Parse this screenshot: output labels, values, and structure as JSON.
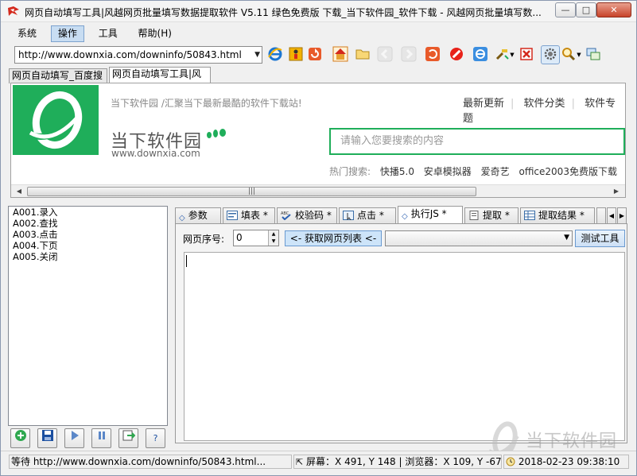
{
  "window": {
    "title": "网页自动填写工具|风越网页批量填写数据提取软件 V5.11 绿色免费版 下载_当下软件园_软件下载 - 风越网页批量填写数...",
    "controls": {
      "minimize": "—",
      "maximize": "□",
      "close": "✕"
    }
  },
  "menu": {
    "items": [
      {
        "label": "系统"
      },
      {
        "label": "操作",
        "active": true
      },
      {
        "label": "工具"
      },
      {
        "label": "帮助(H)"
      }
    ]
  },
  "toolbar": {
    "url": "http://www.downxia.com/downinfo/50843.html"
  },
  "browser_tabs": [
    {
      "label": "网页自动填写_百度搜"
    },
    {
      "label": "网页自动填写工具|风",
      "active": true
    }
  ],
  "webpage": {
    "tagline": "当下软件园 /汇聚当下最新最酷的软件下载站!",
    "nav": [
      "最新更新",
      "软件分类",
      "软件专题"
    ],
    "site_name": "当下软件园",
    "domain": "www.downxia.com",
    "search_placeholder": "请输入您要搜索的内容",
    "hot_label": "热门搜索:",
    "hot_items": [
      "快播5.0",
      "安卓模拟器",
      "爱奇艺",
      "office2003免费版下载"
    ]
  },
  "task_list": [
    "A001.录入",
    "A002.查找",
    "A003.点击",
    "A004.下页",
    "A005.关闭"
  ],
  "left_buttons": [
    "add-icon",
    "save-icon",
    "play-icon",
    "pause-icon",
    "export-icon",
    "?"
  ],
  "panel_tabs": [
    {
      "label": "参数"
    },
    {
      "label": "填表 *"
    },
    {
      "label": "校验码 *"
    },
    {
      "label": "点击 *"
    },
    {
      "label": "执行JS *",
      "active": true
    },
    {
      "label": "提取 *"
    },
    {
      "label": "提取结果 *"
    }
  ],
  "js_panel": {
    "seq_label": "网页序号:",
    "seq_value": "0",
    "get_list_label": "<- 获取网页列表 <-",
    "test_button": "测试工具"
  },
  "status": {
    "left": "等待 http://www.downxia.com/downinfo/50843.html...",
    "coords": "屏幕：X 491, Y 148 | 浏览器：X 109, Y -67",
    "time": "2018-02-23 09:38:10"
  },
  "watermark": {
    "text": "当下软件园"
  },
  "colors": {
    "site_green": "#1fae5a",
    "active_tab_blue": "#cde4f9"
  }
}
